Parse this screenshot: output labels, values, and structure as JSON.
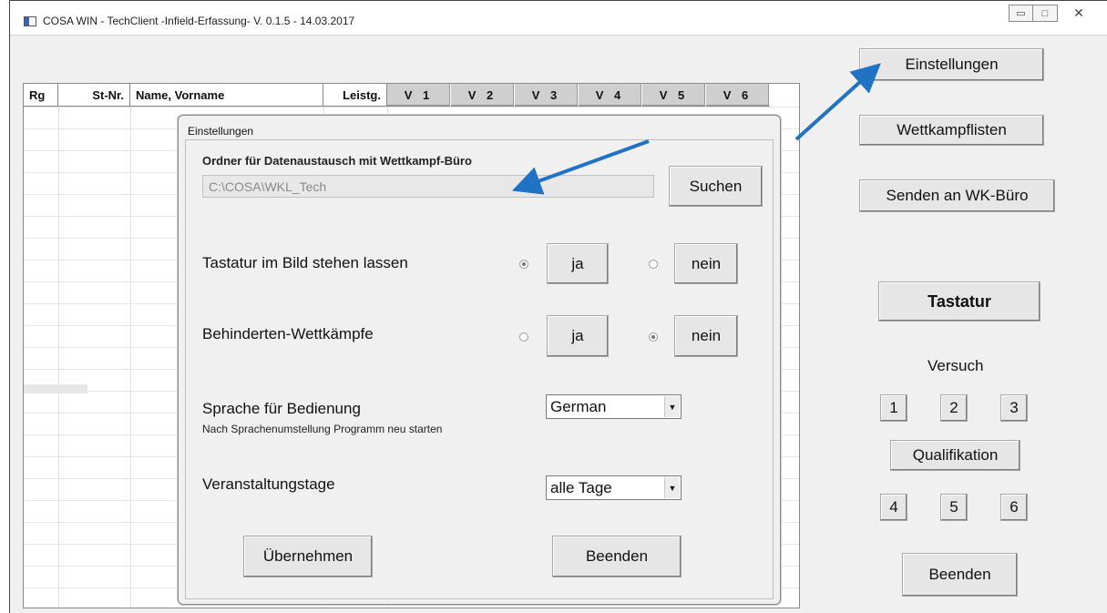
{
  "window": {
    "title": "COSA WIN - TechClient -Infield-Erfassung- V. 0.1.5 - 14.03.2017",
    "controls": {
      "minimize": "▭",
      "maximize": "□",
      "close": "✕"
    }
  },
  "table": {
    "headers": [
      "Rg",
      "St-Nr.",
      "Name, Vorname",
      "Leistg.",
      "V 1",
      "V 2",
      "V 3",
      "V 4",
      "V 5",
      "V 6"
    ]
  },
  "sidebar": {
    "einstellungen": "Einstellungen",
    "wettkampflisten": "Wettkampflisten",
    "senden": "Senden an WK-Büro",
    "tastatur": "Tastatur",
    "versuch_label": "Versuch",
    "versuch_1": "1",
    "versuch_2": "2",
    "versuch_3": "3",
    "qualifikation": "Qualifikation",
    "versuch_4": "4",
    "versuch_5": "5",
    "versuch_6": "6",
    "beenden": "Beenden"
  },
  "dialog": {
    "title": "Einstellungen",
    "folder_label": "Ordner für Datenaustausch mit Wettkampf-Büro",
    "folder_path": "C:\\COSA\\WKL_Tech",
    "search_button": "Suchen",
    "keyboard_label": "Tastatur im Bild stehen lassen",
    "keyboard_yes": "ja",
    "keyboard_no": "nein",
    "keyboard_selected": "ja",
    "disabled_label": "Behinderten-Wettkämpfe",
    "disabled_yes": "ja",
    "disabled_no": "nein",
    "disabled_selected": "nein",
    "language_label": "Sprache für Bedienung",
    "language_hint": "Nach Sprachenumstellung Programm neu starten",
    "language_value": "German",
    "days_label": "Veranstaltungstage",
    "days_value": "alle Tage",
    "apply_button": "Übernehmen",
    "close_button": "Beenden"
  },
  "colors": {
    "annotation_arrow": "#1f72c4",
    "window_bg": "#f0f0f0",
    "header_v_bg": "#cfcfcf"
  }
}
